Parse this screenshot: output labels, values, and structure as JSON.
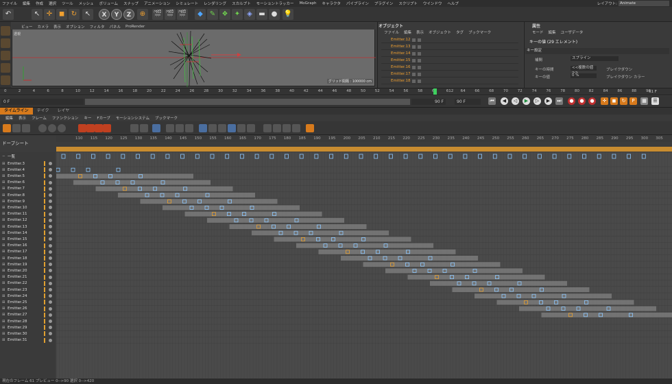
{
  "menubar": {
    "items": [
      "ファイル",
      "編集",
      "作成",
      "選択",
      "ツール",
      "メッシュ",
      "ボリューム",
      "スナップ",
      "アニメーション",
      "シミュレート",
      "レンダリング",
      "スカルプト",
      "モーショントラッカー",
      "MoGraph",
      "キャラクタ",
      "パイプライン",
      "プラグイン",
      "スクリプト",
      "ウインドウ",
      "ヘルプ"
    ],
    "layout_label": "レイアウト:",
    "layout_value": "Animate"
  },
  "toolbar": {
    "axis_x": "X",
    "axis_y": "Y",
    "axis_z": "Z"
  },
  "viewport": {
    "menu": [
      "ビュー",
      "カメラ",
      "表示",
      "オプション",
      "フィルタ",
      "パネル",
      "ProRender"
    ],
    "camera_label": "透視",
    "grid_label": "グリッド間隔 : 100000 cm"
  },
  "objects": {
    "title": "オブジェクト",
    "menu": [
      "ファイル",
      "編集",
      "表示",
      "オブジェクト",
      "タグ",
      "ブックマーク"
    ],
    "rows": [
      "Emitter.12",
      "Emitter.13",
      "Emitter.14",
      "Emitter.15",
      "Emitter.16",
      "Emitter.17",
      "Emitter.18"
    ]
  },
  "attributes": {
    "title": "属性",
    "menu": [
      "モード",
      "編集",
      "ユーザデータ"
    ],
    "heading": "キーの値 (29 エレメント)",
    "group": "キー設定",
    "interp_label": "補間",
    "interp_value": "スプライン",
    "key_time_label": "キーの時間",
    "key_time_value": "<<複数の値>>",
    "key_value_label": "キーの値",
    "key_value_value": "0 %",
    "break_label": "ブレイクダウン",
    "break_color_label": "ブレイクダウン カラー"
  },
  "ruler": {
    "ticks": [
      "0",
      "2",
      "4",
      "6",
      "8",
      "10",
      "12",
      "14",
      "16",
      "18",
      "20",
      "22",
      "24",
      "26",
      "28",
      "30",
      "32",
      "34",
      "36",
      "38",
      "40",
      "42",
      "44",
      "46",
      "48",
      "50",
      "52",
      "54",
      "56",
      "58",
      "60",
      "612",
      "64",
      "66",
      "68",
      "70",
      "72",
      "74",
      "76",
      "78",
      "80",
      "82",
      "84",
      "86",
      "88",
      "90"
    ],
    "current_frame": "61",
    "end_label": "61 F"
  },
  "transport": {
    "start": "0 F",
    "end": "90 F",
    "end2": "90 F"
  },
  "timeline": {
    "tabs": [
      "タイムライン",
      "テイク",
      "レイヤ"
    ],
    "menu": [
      "編集",
      "表示",
      "フレーム",
      "ファンクション",
      "キー",
      "Fカーブ",
      "モーションシステム",
      "ブックマーク"
    ],
    "dope_label": "ドープシート",
    "frame_ticks": [
      "110",
      "115",
      "120",
      "125",
      "130",
      "135",
      "140",
      "145",
      "150",
      "155",
      "160",
      "165",
      "170",
      "175",
      "180",
      "185",
      "190",
      "195",
      "200",
      "205",
      "210",
      "215",
      "220",
      "225",
      "230",
      "235",
      "240",
      "245",
      "250",
      "255",
      "260",
      "265",
      "270",
      "275",
      "280",
      "285",
      "290",
      "295",
      "300",
      "305"
    ],
    "summary_label": "一覧",
    "tracks": [
      "Emitter.3",
      "Emitter.4",
      "Emitter.5",
      "Emitter.6",
      "Emitter.7",
      "Emitter.8",
      "Emitter.9",
      "Emitter.10",
      "Emitter.11",
      "Emitter.12",
      "Emitter.13",
      "Emitter.14",
      "Emitter.15",
      "Emitter.16",
      "Emitter.17",
      "Emitter.18",
      "Emitter.19",
      "Emitter.20",
      "Emitter.21",
      "Emitter.22",
      "Emitter.23",
      "Emitter.24",
      "Emitter.25",
      "Emitter.26",
      "Emitter.27",
      "Emitter.28",
      "Emitter.29",
      "Emitter.30",
      "Emitter.31"
    ]
  },
  "status": {
    "text": "現在のフレーム 61 プレビュー 0-->90  選択 0-->420"
  },
  "colors": {
    "accent": "#d77a1c",
    "playhead": "#3fcf5f",
    "key": "#8ec9ff",
    "key_orange": "#e8a030",
    "track_bar": "#7a7a7a"
  }
}
